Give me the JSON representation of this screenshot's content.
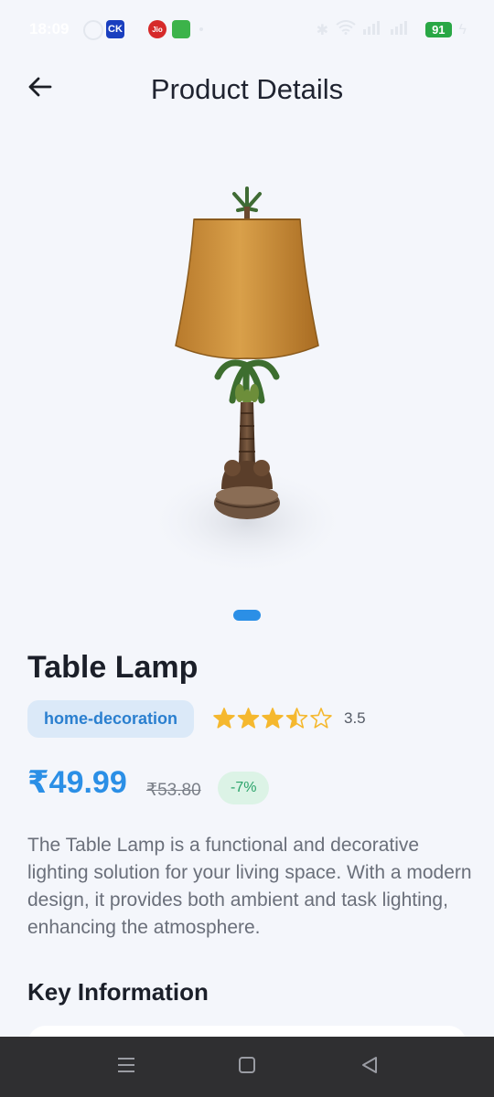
{
  "status_bar": {
    "time": "18:09",
    "app_badge": "CK",
    "carrier_badge": "Jio",
    "battery": "91"
  },
  "header": {
    "title": "Product Details",
    "back_icon": "arrow-left-icon"
  },
  "product": {
    "name": "Table Lamp",
    "category": "home-decoration",
    "rating": 3.5,
    "rating_text": "3.5",
    "rating_max": 5,
    "price": "₹49.99",
    "old_price": "₹53.80",
    "discount": "-7%",
    "description": "The Table Lamp is a functional and decorative lighting solution for your living space. With a modern design, it provides both ambient and task lighting, enhancing the atmosphere.",
    "image_pages": 1,
    "current_image": 1
  },
  "sections": {
    "key_info_title": "Key Information"
  },
  "colors": {
    "accent": "#2b8fe6",
    "star": "#f5b82e",
    "discount_text": "#2aa36a",
    "background": "#f4f6fb"
  },
  "navbar": {
    "icons": [
      "menu-icon",
      "home-square-icon",
      "back-triangle-icon"
    ]
  }
}
